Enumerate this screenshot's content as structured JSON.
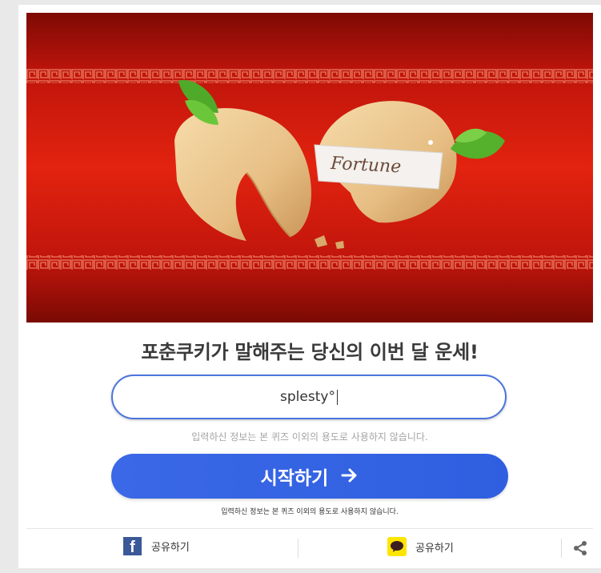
{
  "banner": {
    "caption": "Fortune"
  },
  "title": "포춘쿠키가 말해주는 당신의 이번 달 운세!",
  "name_input": {
    "value": "splesty°"
  },
  "privacy_note": "입력하신 정보는 본 퀴즈 이외의 용도로 사용하지 않습니다.",
  "start_button": {
    "label": "시작하기",
    "icon": "arrow-right-icon"
  },
  "privacy_note_small": "입력하신 정보는 본 퀴즈 이외의 용도로 사용하지 않습니다.",
  "share": {
    "facebook_label": "공유하기",
    "kakao_label": "공유하기",
    "facebook_icon": "facebook-icon",
    "kakao_icon": "kakaotalk-icon",
    "more_icon": "share-icon"
  },
  "colors": {
    "accent": "#3a68e6",
    "banner_red": "#c8150e",
    "facebook": "#3b5998",
    "kakao": "#fee500"
  }
}
